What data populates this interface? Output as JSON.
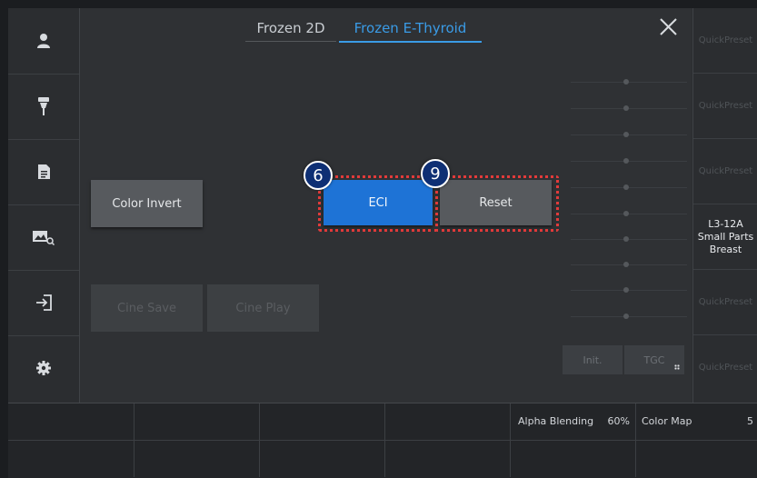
{
  "tabs": [
    "Frozen 2D",
    "Frozen E-Thyroid"
  ],
  "active_tab": 1,
  "sidebar": {
    "items": [
      {
        "icon": "user-icon"
      },
      {
        "icon": "probe-icon"
      },
      {
        "icon": "document-icon"
      },
      {
        "icon": "image-search-icon"
      },
      {
        "icon": "exit-icon"
      },
      {
        "icon": "gear-icon"
      }
    ]
  },
  "main": {
    "color_invert_label": "Color Invert",
    "eci_label": "ECI",
    "reset_label": "Reset",
    "cine_save_label": "Cine Save",
    "cine_play_label": "Cine Play",
    "init_label": "Init.",
    "tgc_label": "TGC",
    "badges": {
      "eci": "6",
      "reset": "9"
    }
  },
  "right_panel": {
    "preset_label": "QuickPreset",
    "probe": {
      "model": "L3-12A",
      "line2": "Small Parts",
      "line3": "Breast"
    }
  },
  "bottom_bar": {
    "alpha_label": "Alpha Blending",
    "alpha_value": "60%",
    "color_map_label": "Color Map",
    "color_map_value": "5"
  },
  "colors": {
    "accent": "#3a9be6",
    "eci_button": "#1e73d6",
    "highlight": "#e23b3b",
    "badge": "#0e2f74"
  }
}
